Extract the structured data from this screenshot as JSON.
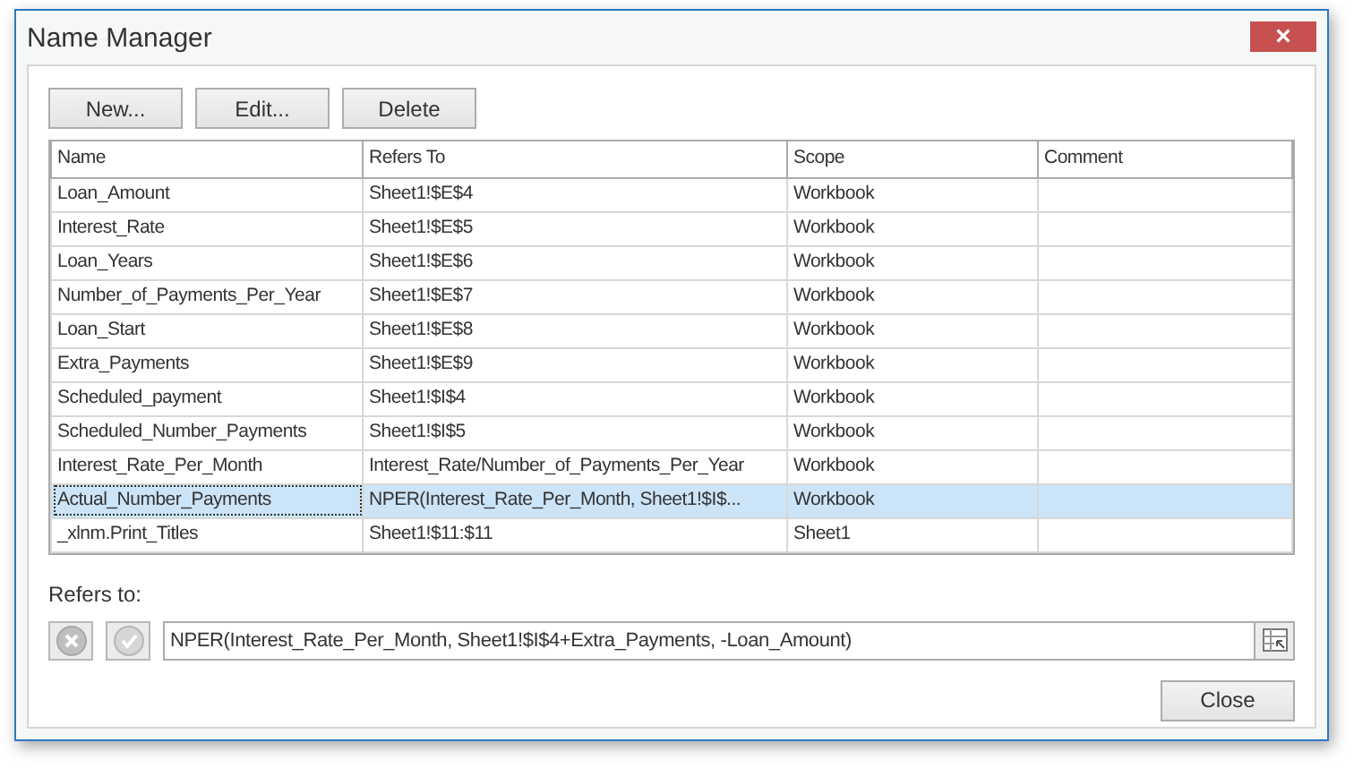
{
  "window": {
    "title": "Name Manager",
    "close": "×"
  },
  "toolbar": [
    "New...",
    "Edit...",
    "Delete"
  ],
  "table": {
    "columns": [
      "Name",
      "Refers To",
      "Scope",
      "Comment"
    ],
    "rows": [
      {
        "name": "Loan_Amount",
        "refers_to": "Sheet1!$E$4",
        "scope": "Workbook",
        "selected": false
      },
      {
        "name": "Interest_Rate",
        "refers_to": "Sheet1!$E$5",
        "scope": "Workbook",
        "selected": false
      },
      {
        "name": "Loan_Years",
        "refers_to": "Sheet1!$E$6",
        "scope": "Workbook",
        "selected": false
      },
      {
        "name": "Number_of_Payments_Per_Year",
        "refers_to": "Sheet1!$E$7",
        "scope": "Workbook",
        "selected": false
      },
      {
        "name": "Loan_Start",
        "refers_to": "Sheet1!$E$8",
        "scope": "Workbook",
        "selected": false
      },
      {
        "name": "Extra_Payments",
        "refers_to": "Sheet1!$E$9",
        "scope": "Workbook",
        "selected": false
      },
      {
        "name": "Scheduled_payment",
        "refers_to": "Sheet1!$I$4",
        "scope": "Workbook",
        "selected": false
      },
      {
        "name": "Scheduled_Number_Payments",
        "refers_to": "Sheet1!$I$5",
        "scope": "Workbook",
        "selected": false
      },
      {
        "name": "Interest_Rate_Per_Month",
        "refers_to": "Interest_Rate/Number_of_Payments_Per_Year",
        "scope": "Workbook",
        "selected": false
      },
      {
        "name": "Actual_Number_Payments",
        "refers_to": "NPER(Interest_Rate_Per_Month, Sheet1!$I$...",
        "scope": "Workbook",
        "selected": true
      },
      {
        "name": "_xlnm.Print_Titles",
        "refers_to": "Sheet1!$11:$11",
        "scope": "Sheet1",
        "selected": false
      }
    ]
  },
  "refers_to": {
    "label": "Refers to:",
    "value": "NPER(Interest_Rate_Per_Month, Sheet1!$I$4+Extra_Payments, -Loan_Amount)",
    "cancel_disabled": true,
    "confirm_disabled": true
  },
  "footer": {
    "close": "Close"
  }
}
